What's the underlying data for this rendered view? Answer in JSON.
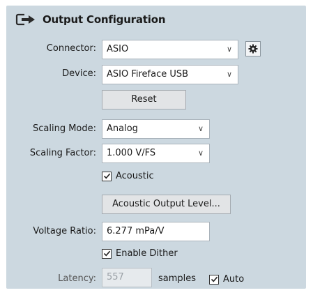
{
  "header": {
    "title": "Output Configuration",
    "icon": "output-arrow-icon"
  },
  "connector": {
    "label": "Connector:",
    "value": "ASIO"
  },
  "device": {
    "label": "Device:",
    "value": "ASIO Fireface USB"
  },
  "reset_label": "Reset",
  "scaling_mode": {
    "label": "Scaling Mode:",
    "value": "Analog"
  },
  "scaling_factor": {
    "label": "Scaling Factor:",
    "value": "1.000 V/FS"
  },
  "acoustic": {
    "label": "Acoustic",
    "checked": true
  },
  "acoustic_output_label": "Acoustic Output Level...",
  "voltage_ratio": {
    "label": "Voltage Ratio:",
    "value": "6.277 mPa/V"
  },
  "enable_dither": {
    "label": "Enable Dither",
    "checked": true
  },
  "latency": {
    "label": "Latency:",
    "value": "557",
    "unit": "samples",
    "auto_label": "Auto",
    "auto_checked": true
  }
}
